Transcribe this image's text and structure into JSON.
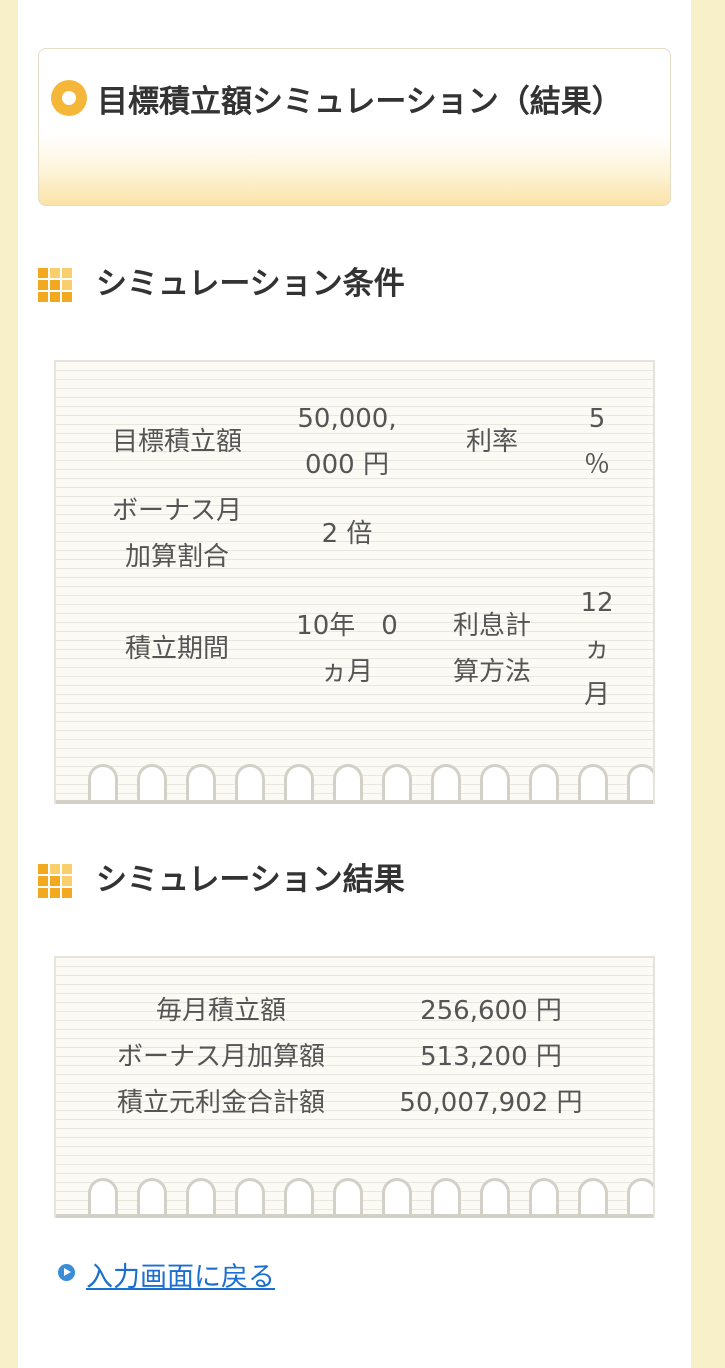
{
  "page": {
    "title": "目標積立額シミュレーション（結果）"
  },
  "conditions": {
    "heading": "シミュレーション条件",
    "target_label": "目標積立額",
    "target_value_line1": "50,000,",
    "target_value_line2": "000 円",
    "rate_label": "利率",
    "rate_value_line1": "5",
    "rate_value_line2": "％",
    "bonus_label_line1": "ボーナス月",
    "bonus_label_line2": "加算割合",
    "bonus_value": "2 倍",
    "period_label": "積立期間",
    "period_value_line1": "10年　0",
    "period_value_line2": "ヵ月",
    "interest_label_line1": "利息計",
    "interest_label_line2": "算方法",
    "interest_value_line1": "12",
    "interest_value_line2": "ヵ",
    "interest_value_line3": "月"
  },
  "results": {
    "heading": "シミュレーション結果",
    "rows": [
      {
        "label": "毎月積立額",
        "value": "256,600 円"
      },
      {
        "label": "ボーナス月加算額",
        "value": "513,200 円"
      },
      {
        "label": "積立元利金合計額",
        "value": "50,007,902 円"
      }
    ]
  },
  "back_link": {
    "label": "入力画面に戻る",
    "icon": "play-circle-icon"
  },
  "colors": {
    "accent": "#f5b73a",
    "link": "#1a6fd0",
    "side_background": "#f7f0c8"
  }
}
